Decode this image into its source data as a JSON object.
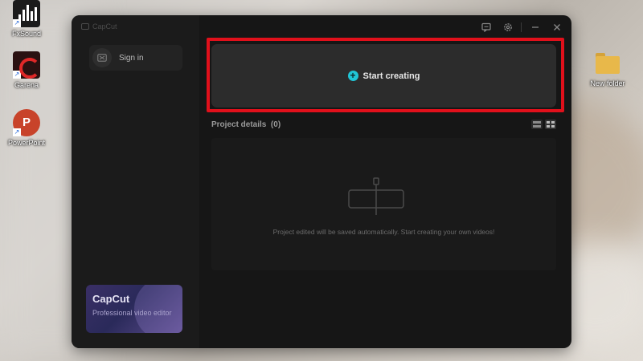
{
  "desktop": {
    "icons": [
      {
        "label": "FxSound",
        "icon": "fxsound-icon"
      },
      {
        "label": "Garena",
        "icon": "garena-icon"
      },
      {
        "label": "PowerPoint",
        "icon": "powerpoint-icon"
      },
      {
        "label": "New folder",
        "icon": "folder-icon"
      }
    ],
    "ppt_glyph": "P"
  },
  "app": {
    "brand": "CapCut",
    "sidebar": {
      "sign_in_label": "Sign in",
      "promo_title": "CapCut",
      "promo_subtitle": "Professional video editor"
    },
    "main": {
      "start_button_label": "Start creating",
      "start_button_icon": "+",
      "project_details_label": "Project details",
      "project_count": "(0)",
      "empty_message": "Project edited will be saved automatically. Start creating your own videos!"
    }
  },
  "colors": {
    "accent": "#20c5d6",
    "highlight": "#e1101b",
    "window_bg": "#161616"
  }
}
